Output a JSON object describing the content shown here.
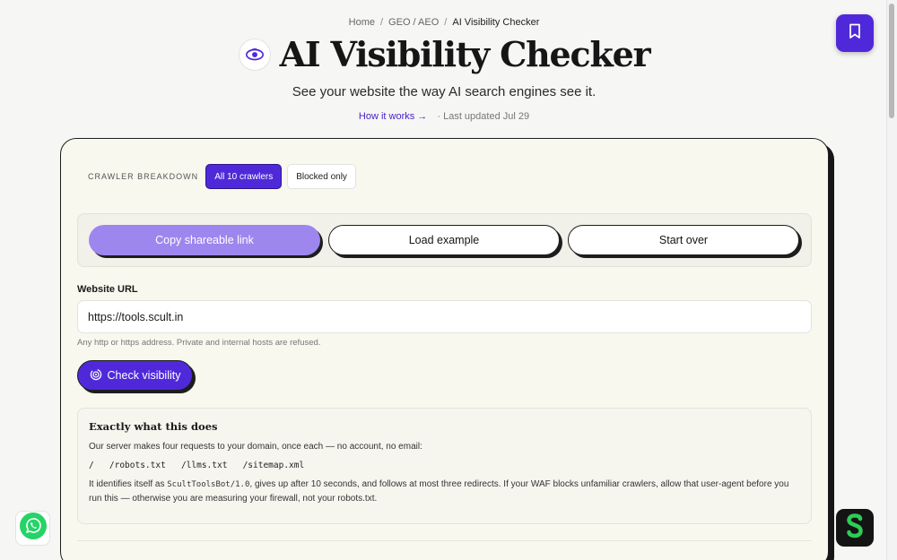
{
  "breadcrumb": {
    "items": [
      "Home",
      "GEO / AEO",
      "AI Visibility Checker"
    ],
    "separator": "/"
  },
  "header": {
    "title": "AI Visibility Checker",
    "subtitle": "See your website the way AI search engines see it.",
    "how_it_works": "How it works →",
    "last_updated": "· Last updated Jul 29"
  },
  "crawler": {
    "label": "CRAWLER BREAKDOWN",
    "filters": [
      "All 10 crawlers",
      "Blocked only"
    ],
    "active_filter": "All 10 crawlers"
  },
  "actions": {
    "copy_label": "Copy shareable link",
    "load_label": "Load example",
    "start_label": "Start over"
  },
  "form": {
    "url_label": "Website URL",
    "url_value": "https://tools.scult.in",
    "hint": "Any http or https address. Private and internal hosts are refused.",
    "submit_label": "Check visibility"
  },
  "info": {
    "title": "Exactly what this does",
    "line1": "Our server makes four requests to your domain, once each — no account, no email:",
    "paths": "/   /robots.txt   /llms.txt   /sitemap.xml",
    "line2_prefix": "It identifies itself as ",
    "user_agent": "ScultToolsBot/1.0",
    "line2_suffix": ", gives up after 10 seconds, and follows at most three redirects. If your WAF blocks unfamiliar crawlers, allow that user-agent before you run this — otherwise you are measuring your firewall, not your robots.txt."
  },
  "colors": {
    "accent": "#4f29d9",
    "accent_soft": "#9d86ee",
    "card_bg": "#f8f8ef",
    "whatsapp": "#25d366",
    "brand_green": "#2ecc55"
  },
  "icons": {
    "title": "eye-icon",
    "bookmark": "bookmark-icon",
    "check": "radar-icon",
    "whatsapp": "whatsapp-icon",
    "sidekick": "scult-logo-icon"
  }
}
